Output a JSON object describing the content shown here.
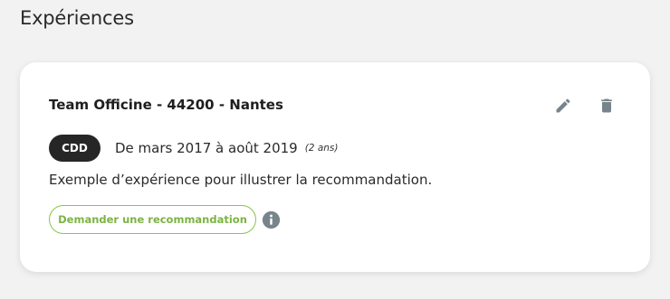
{
  "section": {
    "title": "Expériences"
  },
  "experience": {
    "title": "Team Officine - 44200 - Nantes",
    "contract_type": "CDD",
    "dates": "De mars 2017 à août 2019",
    "duration": "(2 ans)",
    "description": "Exemple d’expérience pour illustrer la recommandation.",
    "recommend_label": "Demander une recommandation",
    "actions": {
      "edit_icon": "pencil-icon",
      "delete_icon": "trash-icon",
      "info_icon": "info-icon"
    }
  },
  "colors": {
    "background": "#f2f2f2",
    "card": "#ffffff",
    "badge": "#262626",
    "accent_green": "#8bc34a",
    "icon_gray": "#78848c"
  }
}
